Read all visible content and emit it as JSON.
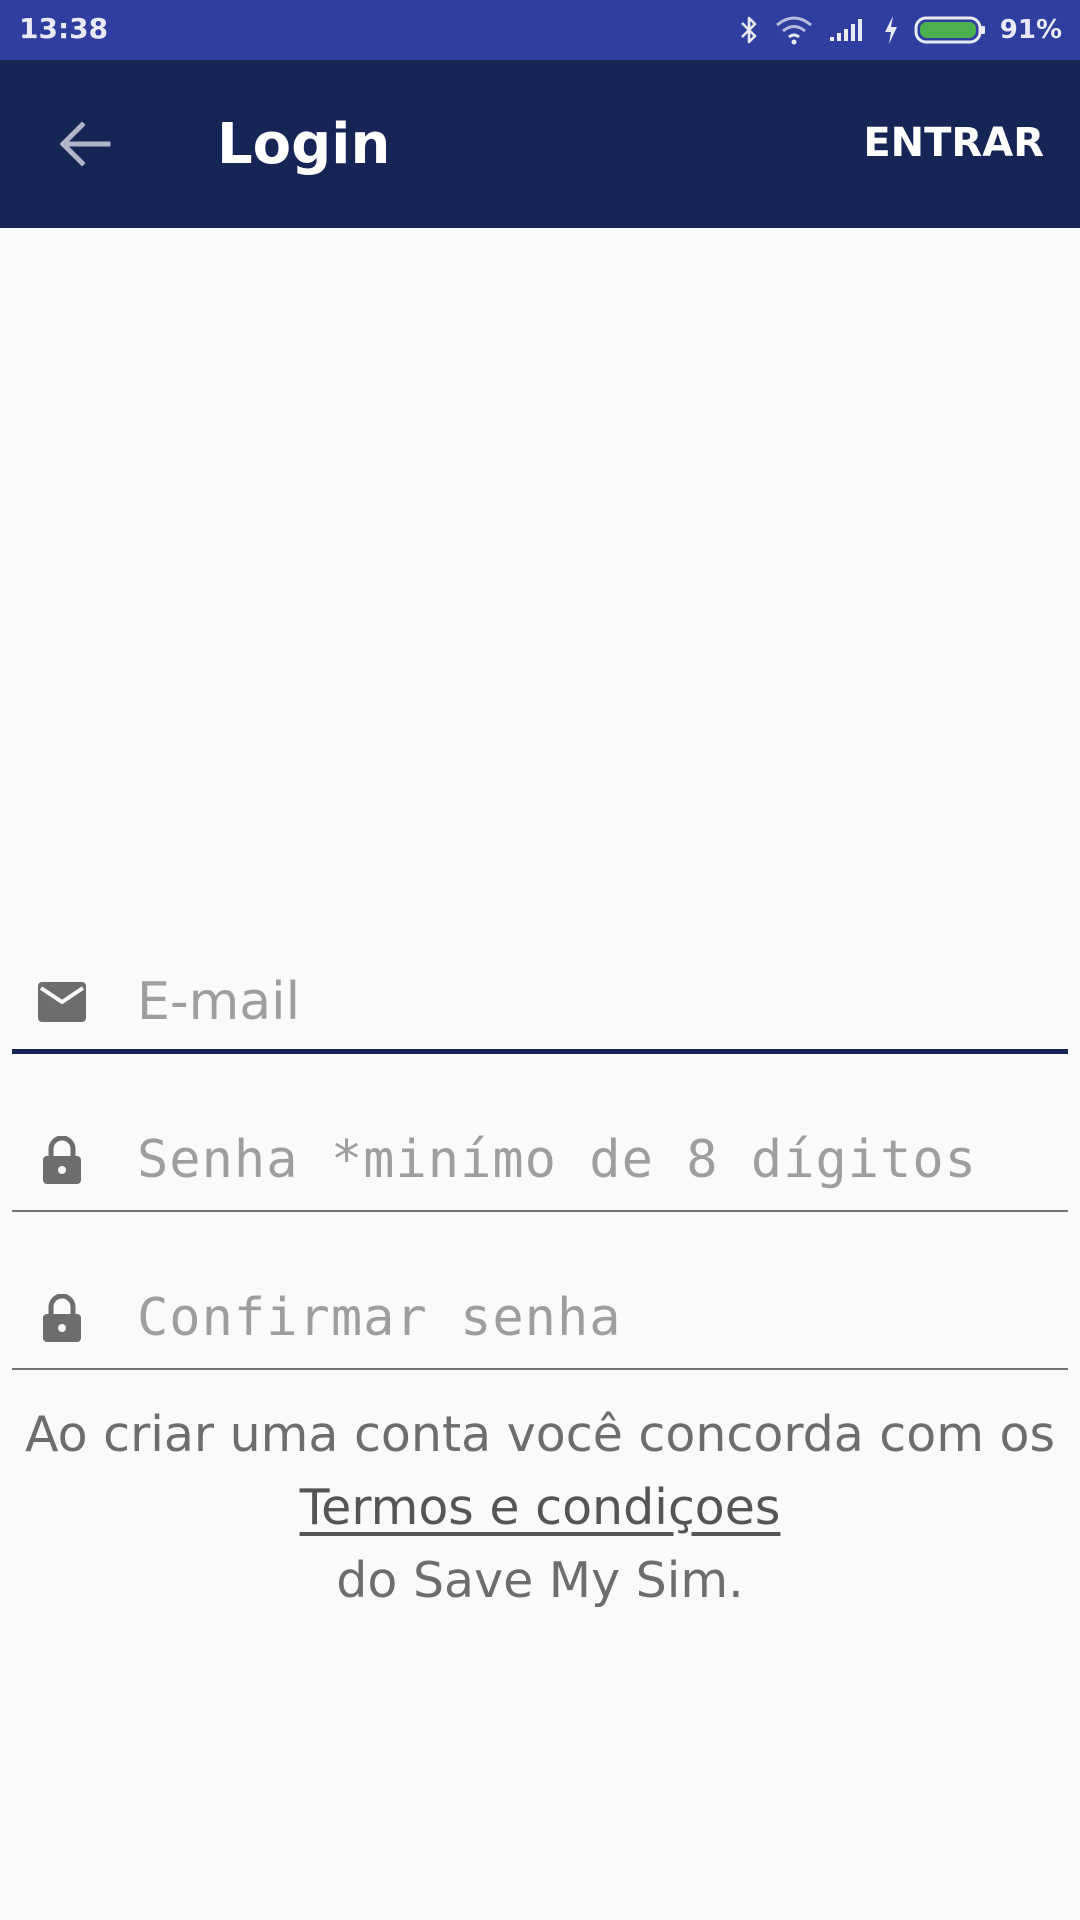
{
  "status_bar": {
    "time": "13:38",
    "icons": [
      "bluetooth-icon",
      "wifi-icon",
      "signal-icon",
      "charging-icon",
      "battery-icon"
    ],
    "battery_percent": "91%",
    "colors": {
      "background": "#303f9f",
      "battery_fill": "#4caf50"
    }
  },
  "app_bar": {
    "back_icon": "arrow-back-icon",
    "title": "Login",
    "action_label": "ENTRAR",
    "colors": {
      "background": "#162456",
      "text": "#ffffff"
    }
  },
  "form": {
    "email": {
      "icon": "mail-icon",
      "placeholder": "E-mail",
      "value": ""
    },
    "password": {
      "icon": "lock-icon",
      "placeholder": "Senha *minímo de 8 dígitos",
      "value": ""
    },
    "confirm_password": {
      "icon": "lock-icon",
      "placeholder": "Confirmar senha",
      "value": ""
    }
  },
  "terms": {
    "line1": "Ao criar uma conta você concorda com os",
    "link": "Termos e condiçoes",
    "line3": "do Save My Sim."
  }
}
